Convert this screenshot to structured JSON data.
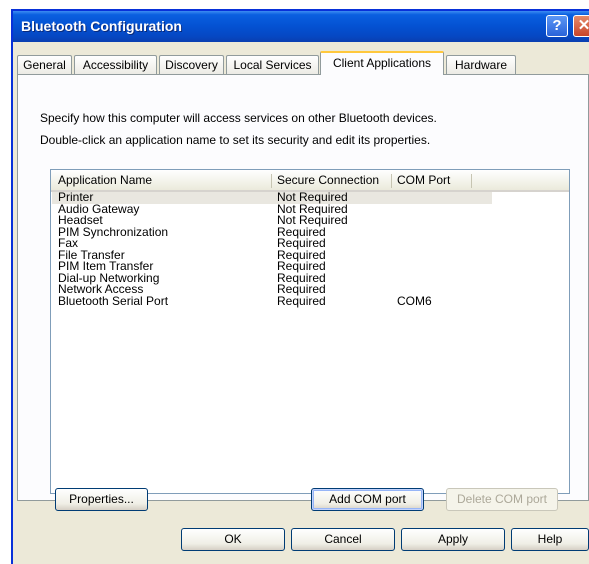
{
  "window": {
    "title": "Bluetooth Configuration",
    "help_glyph": "?",
    "close_glyph": "✕"
  },
  "tabs": [
    {
      "label": "General",
      "active": false
    },
    {
      "label": "Accessibility",
      "active": false
    },
    {
      "label": "Discovery",
      "active": false
    },
    {
      "label": "Local Services",
      "active": false
    },
    {
      "label": "Client Applications",
      "active": true
    },
    {
      "label": "Hardware",
      "active": false
    }
  ],
  "panel": {
    "description_line1": "Specify how this computer will access services on other Bluetooth devices.",
    "description_line2": "Double-click an application name to set its security and edit its properties."
  },
  "list": {
    "columns": [
      "Application Name",
      "Secure Connection",
      "COM Port"
    ],
    "rows": [
      {
        "name": "Printer",
        "secure": "Not Required",
        "port": "",
        "selected": true
      },
      {
        "name": "Audio Gateway",
        "secure": "Not Required",
        "port": ""
      },
      {
        "name": "Headset",
        "secure": "Not Required",
        "port": ""
      },
      {
        "name": "PIM Synchronization",
        "secure": "Required",
        "port": ""
      },
      {
        "name": "Fax",
        "secure": "Required",
        "port": ""
      },
      {
        "name": "File Transfer",
        "secure": "Required",
        "port": ""
      },
      {
        "name": "PIM Item Transfer",
        "secure": "Required",
        "port": ""
      },
      {
        "name": "Dial-up Networking",
        "secure": "Required",
        "port": ""
      },
      {
        "name": "Network Access",
        "secure": "Required",
        "port": ""
      },
      {
        "name": "Bluetooth Serial Port",
        "secure": "Required",
        "port": "COM6"
      }
    ]
  },
  "panel_buttons": {
    "properties": "Properties...",
    "add_com_port": "Add COM port",
    "delete_com_port": "Delete COM port"
  },
  "dialog_buttons": {
    "ok": "OK",
    "cancel": "Cancel",
    "apply": "Apply",
    "help": "Help"
  },
  "colors": {
    "titlebar": "#0453d4",
    "active_tab_highlight": "#ffc83c",
    "dialog_face": "#ece9d8"
  }
}
